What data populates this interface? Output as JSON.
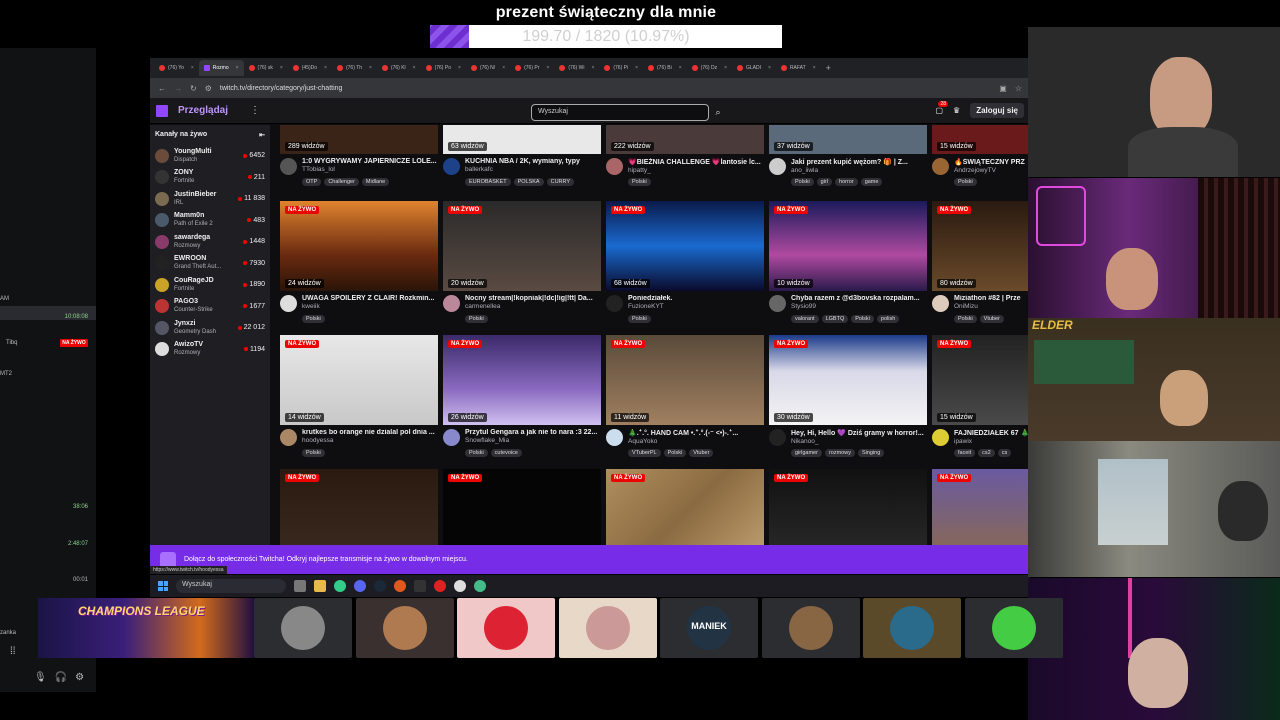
{
  "donation": {
    "title": "prezent świąteczny dla mnie",
    "amount_text": "199.70 / 1820 (10.97%)",
    "progress_fraction": 0.1097
  },
  "left_panel": {
    "items": [
      "AM",
      "Tibq",
      "MT2"
    ],
    "timestamps": [
      "10:08:08",
      "38:06",
      "2:48:07",
      "00:01"
    ],
    "live_label": "NA ŻYWO",
    "bottom_label": "zanka"
  },
  "browser": {
    "tabs": [
      "(76) Yo",
      "Rozmo",
      "(76) sk",
      "(45)Do",
      "(76) Th",
      "(76) Kl",
      "(76) Po",
      "(76) N/",
      "(76) Pr",
      "(76) Wi",
      "(76) Pi",
      "(76) Bi",
      "(76) Dz",
      "GLADI",
      "RAFAT"
    ],
    "active_tab_index": 1,
    "url": "twitch.tv/directory/category/just-chatting"
  },
  "twitch": {
    "browse_label": "Przeglądaj",
    "search_placeholder": "Wyszukaj",
    "notif_count": "28",
    "login_label": "Zaloguj się",
    "sidebar_title": "Kanały na żywo",
    "channels": [
      {
        "name": "YoungMulti",
        "category": "Dispatch",
        "viewers": "6452",
        "color": "#6b4b3a"
      },
      {
        "name": "ZONY",
        "category": "Fortnite",
        "viewers": "211",
        "color": "#333"
      },
      {
        "name": "JustinBieber",
        "category": "IRL",
        "viewers": "11 838",
        "color": "#7a6a50"
      },
      {
        "name": "Mamm0n",
        "category": "Path of Exile 2",
        "viewers": "483",
        "color": "#4a5a6a"
      },
      {
        "name": "sawardega",
        "category": "Rozmowy",
        "viewers": "1448",
        "color": "#8a3a6a"
      },
      {
        "name": "EWROON",
        "category": "Grand Theft Aut...",
        "viewers": "7930",
        "color": "#222"
      },
      {
        "name": "CouRageJD",
        "category": "Fortnite",
        "viewers": "1890",
        "color": "#c9a227"
      },
      {
        "name": "PAGO3",
        "category": "Counter-Strike",
        "viewers": "1677",
        "color": "#b33"
      },
      {
        "name": "Jynxzi",
        "category": "Geometry Dash",
        "viewers": "22 012",
        "color": "#556"
      },
      {
        "name": "AwizoTV",
        "category": "Rozmowy",
        "viewers": "1194",
        "color": "#ddd"
      }
    ],
    "top_row": [
      {
        "viewers": "289 widzów",
        "title": "1:0 WYGRYWAMY JAPIERNICZE LOLE...",
        "channel": "TTobias_lol",
        "tags": [
          "OTP",
          "Challenger",
          "Midlane"
        ],
        "thumb": "#3a2418",
        "av": "#555"
      },
      {
        "viewers": "63 widzów",
        "title": "KUCHNIA NBA / 2K, wymiany, typy",
        "channel": "ballerkafc",
        "tags": [
          "EUROBASKET",
          "POLSKA",
          "CURRY"
        ],
        "thumb": "#e8e8e8",
        "av": "#1d428a"
      },
      {
        "viewers": "222 widzów",
        "title": "💗BIEŻNIA CHALLENGE 💗lantosie lc...",
        "channel": "hipatty_",
        "tags": [
          "Polski"
        ],
        "thumb": "#4a3a3a",
        "av": "#a66"
      },
      {
        "viewers": "37 widzów",
        "title": "Jaki prezent kupić wężom? 🎁 | Z...",
        "channel": "ano_iiwla",
        "tags": [
          "Polski",
          "girl",
          "horror",
          "game"
        ],
        "thumb": "#5a6a7a",
        "av": "#ccc"
      },
      {
        "viewers": "15 widzów",
        "title": "🔥ŚWIĄTECZNY PRZ",
        "channel": "AndrzejowyTV",
        "tags": [
          "Polski"
        ],
        "thumb": "#6a1a1a",
        "av": "#963"
      }
    ],
    "live_label": "NA ŻYWO",
    "rows": [
      [
        {
          "viewers": "24 widzów",
          "title": "UWAGA SPOILERY Z CLAIR! Rozkmin...",
          "channel": "kweiik",
          "tags": [
            "Polski"
          ],
          "thumb": "linear-gradient(180deg,#e0832e,#6a2a10 60%,#2a1408)",
          "av": "#ddd"
        },
        {
          "viewers": "20 widzów",
          "title": "Nocny stream|!kopniak|!dc|!ig|!tt| Da...",
          "channel": "carmenellea",
          "tags": [
            "Polski"
          ],
          "thumb": "linear-gradient(180deg,#2a2a2a,#5a4a42)",
          "av": "#b89"
        },
        {
          "viewers": "68 widzów",
          "title": "Poniedziałek.",
          "channel": "FuzioneKYT",
          "tags": [
            "Polski"
          ],
          "thumb": "linear-gradient(180deg,#0a1a4a,#1a6ad0 50%,#0a0a2a)",
          "av": "#222"
        },
        {
          "viewers": "10 widzów",
          "title": "Chyba razem z @d3bovska rozpalam...",
          "channel": "Stysio99",
          "tags": [
            "valorant",
            "LGBTQ",
            "Polski",
            "polish"
          ],
          "thumb": "linear-gradient(180deg,#1a1a5a,#b04aa0 60%,#2a1a4a)",
          "av": "#666"
        },
        {
          "viewers": "80 widzów",
          "title": "Miziathon #82 | Prze",
          "channel": "OniMizu",
          "tags": [
            "Polski",
            "Vtuber"
          ],
          "thumb": "linear-gradient(180deg,#2a1a10,#6a4a2a)",
          "av": "#dcb"
        }
      ],
      [
        {
          "viewers": "14 widzów",
          "title": "krutkes bo orange nie dzialal pol dnia ...",
          "channel": "hoodyessa",
          "tags": [
            "Polski"
          ],
          "thumb": "linear-gradient(180deg,#e8e8e8,#c8c8c8)",
          "av": "#a86"
        },
        {
          "viewers": "26 widzów",
          "title": "Przytul Gengara a jak nie to nara :3 22...",
          "channel": "Snowflake_Mia",
          "tags": [
            "Polski",
            "cutevoice"
          ],
          "thumb": "linear-gradient(180deg,#3a2a6a,#8a6ac0 60%,#d0c0f0)",
          "av": "#88c"
        },
        {
          "viewers": "11 widzów",
          "title": "🎄.ꜜ.°. HAND CAM •.ꜜ.°.(-⁻ <•)-.ꜜ...",
          "channel": "AquaYoko",
          "tags": [
            "VTuberPL",
            "Polski",
            "Vtuber"
          ],
          "thumb": "linear-gradient(180deg,#5a4a3a,#a08060)",
          "av": "#cde"
        },
        {
          "viewers": "30 widzów",
          "title": "Hey, Hi, Hello 💜 Dziś gramy w horror!...",
          "channel": "Nikanoo_",
          "tags": [
            "girlgamer",
            "rozmowy",
            "Singing"
          ],
          "thumb": "linear-gradient(180deg,#1a3a8a,#d8d8e8 40%,#f4f4f4)",
          "av": "#222"
        },
        {
          "viewers": "15 widzów",
          "title": "FAJNIEDZIAŁEK 67 🎄",
          "channel": "ipawix",
          "tags": [
            "faceit",
            "cs2",
            "cs"
          ],
          "thumb": "linear-gradient(180deg,#222,#4a4a4a)",
          "av": "#dc3"
        }
      ],
      [
        {
          "viewers": "",
          "title": "",
          "channel": "",
          "tags": [],
          "thumb": "linear-gradient(180deg,#2a1a10,#3a2a20)",
          "av": "#555"
        },
        {
          "viewers": "",
          "title": "",
          "channel": "",
          "tags": [],
          "thumb": "#050505",
          "av": "#555"
        },
        {
          "viewers": "",
          "title": "",
          "channel": "",
          "tags": [],
          "thumb": "linear-gradient(135deg,#b09060,#8a6a40 50%,#c0a070)",
          "av": "#555"
        },
        {
          "viewers": "",
          "title": "",
          "channel": "",
          "tags": [],
          "thumb": "linear-gradient(180deg,#111,#2a2a2a)",
          "av": "#555"
        },
        {
          "viewers": "",
          "title": "",
          "channel": "",
          "tags": [],
          "thumb": "linear-gradient(180deg,#6a5aa0,#8a6a50)",
          "av": "#555"
        }
      ]
    ],
    "banner_text": "Dołącz do społeczności Twitcha!  Odkryj najlepsze transmisje na żywo w dowolnym miejscu.",
    "status_url": "https://www.twitch.tv/hoodyessa"
  },
  "taskbar": {
    "search_placeholder": "Wyszukaj"
  },
  "overlay_text": {
    "elder": "ELDER"
  },
  "tiles": {
    "champions_label": "CHAMPIONS LEAGUE",
    "items": [
      {
        "bg": "#2b2d31",
        "face": "#888"
      },
      {
        "bg": "#3a3030",
        "face": "#b07a50"
      },
      {
        "bg": "#f0c8c8",
        "face": "#d23"
      },
      {
        "bg": "#e8d8c8",
        "face": "#c99"
      },
      {
        "bg": "#2b2d31",
        "face": "#234"
      },
      {
        "bg": "#2b2d31",
        "face": "#864"
      },
      {
        "bg": "#5a4a2a",
        "face": "#2a6a8a"
      },
      {
        "bg": "#2b2d31",
        "face": "#4c4"
      }
    ],
    "maniek_label": "MANIEK"
  }
}
